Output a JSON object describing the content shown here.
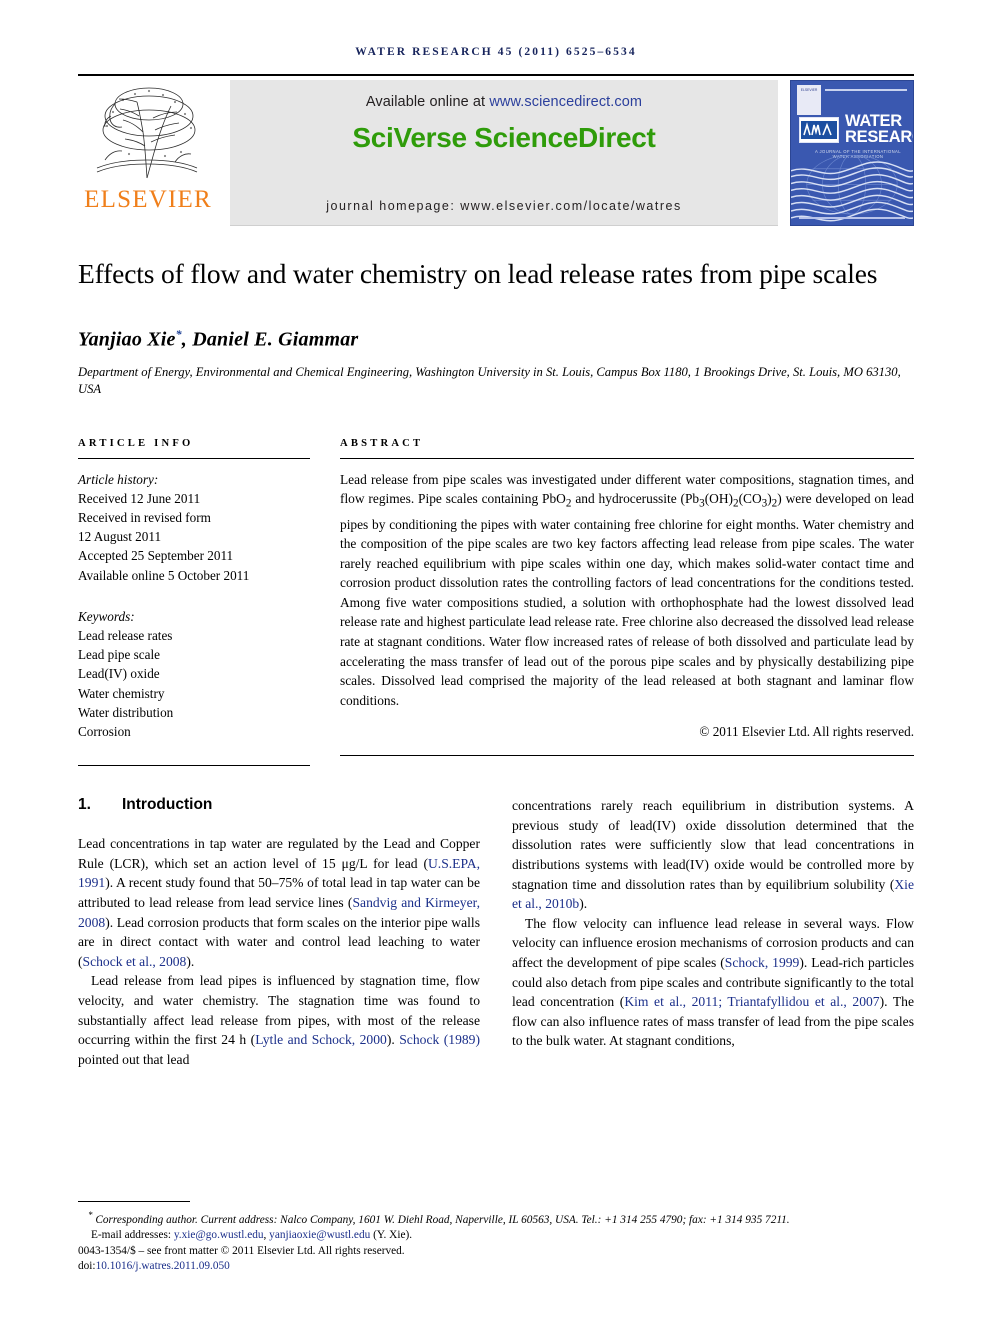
{
  "running_head": "WATER RESEARCH 45 (2011) 6525–6534",
  "masthead": {
    "elsevier_wordmark": "ELSEVIER",
    "available_prefix": "Available online at ",
    "available_url": "www.sciencedirect.com",
    "sciencedirect_logo": "SciVerse ScienceDirect",
    "journal_homepage": "journal homepage: www.elsevier.com/locate/watres",
    "cover": {
      "publisher": "ELSEVIER",
      "iwa": "IWA",
      "title_line1": "WATER",
      "title_line2": "RESEARCH",
      "subtitle": "A JOURNAL OF THE INTERNATIONAL WATER ASSOCIATION"
    }
  },
  "article": {
    "title": "Effects of flow and water chemistry on lead release rates from pipe scales",
    "authors": "Yanjiao Xie",
    "author_marker": "*",
    "authors_rest": ", Daniel E. Giammar",
    "affiliation": "Department of Energy, Environmental and Chemical Engineering, Washington University in St. Louis, Campus Box 1180, 1 Brookings Drive, St. Louis, MO 63130, USA"
  },
  "info": {
    "heading": "ARTICLE INFO",
    "history_label": "Article history:",
    "history": [
      "Received 12 June 2011",
      "Received in revised form",
      "12 August 2011",
      "Accepted 25 September 2011",
      "Available online 5 October 2011"
    ],
    "keywords_label": "Keywords:",
    "keywords": [
      "Lead release rates",
      "Lead pipe scale",
      "Lead(IV) oxide",
      "Water chemistry",
      "Water distribution",
      "Corrosion"
    ]
  },
  "abstract": {
    "heading": "ABSTRACT",
    "part1": "Lead release from pipe scales was investigated under different water compositions, stagnation times, and flow regimes. Pipe scales containing PbO",
    "sub1": "2",
    "part2": " and hydrocerussite (Pb",
    "sub2": "3",
    "part3": "(OH)",
    "sub3": "2",
    "part4": "(CO",
    "sub4": "3",
    "part5": ")",
    "sub5": "2",
    "part6": ") were developed on lead pipes by conditioning the pipes with water containing free chlorine for eight months. Water chemistry and the composition of the pipe scales are two key factors affecting lead release from pipe scales. The water rarely reached equilibrium with pipe scales within one day, which makes solid-water contact time and corrosion product dissolution rates the controlling factors of lead concentrations for the conditions tested. Among five water compositions studied, a solution with orthophosphate had the lowest dissolved lead release rate and highest particulate lead release rate. Free chlorine also decreased the dissolved lead release rate at stagnant conditions. Water flow increased rates of release of both dissolved and particulate lead by accelerating the mass transfer of lead out of the porous pipe scales and by physically destabilizing pipe scales. Dissolved lead comprised the majority of the lead released at both stagnant and laminar flow conditions.",
    "copyright": "© 2011 Elsevier Ltd. All rights reserved."
  },
  "body": {
    "section_number": "1.",
    "section_title": "Introduction",
    "left": {
      "p1_a": "Lead concentrations in tap water are regulated by the Lead and Copper Rule (LCR), which set an action level of 15 μg/L for lead (",
      "p1_cite1": "U.S.EPA, 1991",
      "p1_b": "). A recent study found that 50–75% of total lead in tap water can be attributed to lead release from lead service lines (",
      "p1_cite2": "Sandvig and Kirmeyer, 2008",
      "p1_c": "). Lead corrosion products that form scales on the interior pipe walls are in direct contact with water and control lead leaching to water (",
      "p1_cite3": "Schock et al., 2008",
      "p1_d": ").",
      "p2_a": "Lead release from lead pipes is influenced by stagnation time, flow velocity, and water chemistry. The stagnation time was found to substantially affect lead release from pipes, with most of the release occurring within the first 24 h (",
      "p2_cite1": "Lytle and Schock, 2000",
      "p2_b": "). ",
      "p2_cite2": "Schock (1989)",
      "p2_c": " pointed out that lead"
    },
    "right": {
      "p1_a": "concentrations rarely reach equilibrium in distribution systems. A previous study of lead(IV) oxide dissolution determined that the dissolution rates were sufficiently slow that lead concentrations in distributions systems with lead(IV) oxide would be controlled more by stagnation time and dissolution rates than by equilibrium solubility (",
      "p1_cite1": "Xie et al., 2010b",
      "p1_b": ").",
      "p2_a": "The flow velocity can influence lead release in several ways. Flow velocity can influence erosion mechanisms of corrosion products and can affect the development of pipe scales (",
      "p2_cite1": "Schock, 1999",
      "p2_b": "). Lead-rich particles could also detach from pipe scales and contribute significantly to the total lead concentration (",
      "p2_cite2": "Kim et al., 2011; Triantafyllidou et al., 2007",
      "p2_c": "). The flow can also influence rates of mass transfer of lead from the pipe scales to the bulk water. At stagnant conditions,"
    }
  },
  "footnotes": {
    "corresponding_marker": "*",
    "corresponding": " Corresponding author. Current address: Nalco Company, 1601 W. Diehl Road, Naperville, IL 60563, USA. Tel.: +1 314 255 4790; fax: +1 314 935 7211.",
    "email_label": "E-mail addresses: ",
    "email1": "y.xie@go.wustl.edu",
    "email_sep": ", ",
    "email2": "yanjiaoxie@wustl.edu",
    "email_suffix": " (Y. Xie).",
    "issn_line": "0043-1354/$ – see front matter © 2011 Elsevier Ltd. All rights reserved.",
    "doi_label": "doi:",
    "doi": "10.1016/j.watres.2011.09.050"
  },
  "colors": {
    "running_head": "#17245c",
    "elsevier_orange": "#f07f1a",
    "sciencedirect_green": "#2f9c0a",
    "link_blue": "#1b2f8a",
    "cover_blue": "#3a58b0",
    "banner_gray": "#e6e6e6"
  }
}
